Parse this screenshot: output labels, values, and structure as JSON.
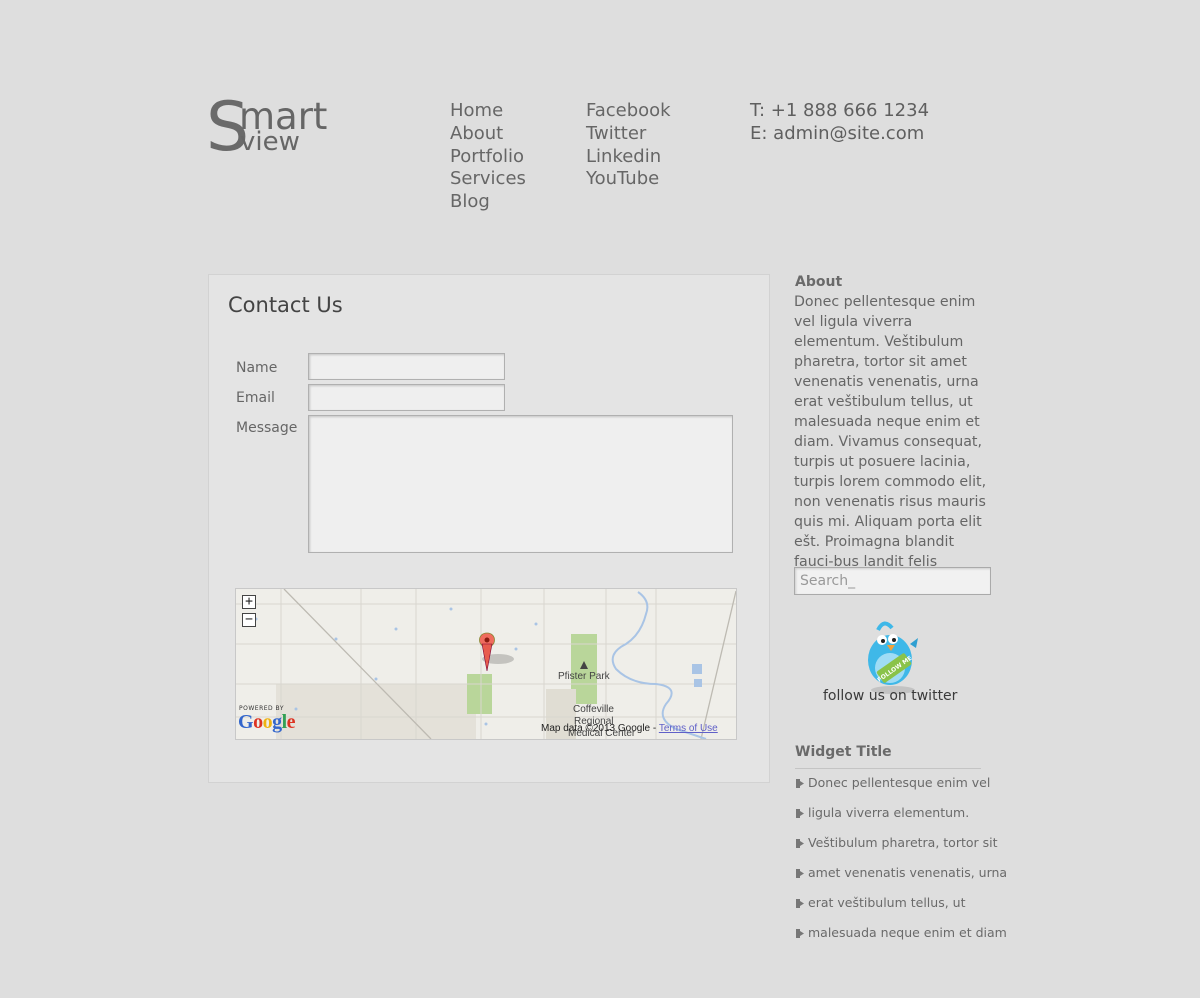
{
  "logo": {
    "letter": "S",
    "word1": "mart",
    "word2": "view"
  },
  "nav": {
    "main": [
      "Home",
      "About",
      "Portfolio",
      "Services",
      "Blog"
    ],
    "social": [
      "Facebook",
      "Twitter",
      "Linkedin",
      "YouTube"
    ]
  },
  "contact_info": {
    "phone": "T: +1 888 666 1234",
    "email": "E: admin@site.com"
  },
  "contact_form": {
    "title": "Contact Us",
    "name_label": "Name",
    "email_label": "Email",
    "message_label": "Message",
    "name_value": "",
    "email_value": "",
    "message_value": ""
  },
  "map": {
    "zoom_in": "+",
    "zoom_out": "−",
    "powered_by": "POWERED BY",
    "google_letters": [
      "G",
      "o",
      "o",
      "g",
      "l",
      "e"
    ],
    "map_data": "Map data ©2013 Google -",
    "terms": "Terms of Use",
    "places": {
      "park": "Pfister Park",
      "city": "Coffeville",
      "regional": "Regional",
      "medical": "Medical Center"
    },
    "marker_icon": "map-marker-icon"
  },
  "sidebar": {
    "about_title": "About",
    "about_text": "Donec pellentesque enim vel ligula viverra elementum. Veštibulum pharetra, tortor sit amet venenatis venenatis, urna erat veštibulum tellus, ut malesuada neque enim et diam. Vivamus consequat, turpis ut posuere lacinia, turpis lorem commodo elit, non venenatis risus mauris quis mi. Aliquam porta elit ešt. Proimagna blandit fauci-bus landit felis aliquet at.",
    "search_placeholder": "Search_",
    "twitter_badge": "FOLLOW ME",
    "follow_text": "follow us on twitter",
    "widget_title": "Widget Title",
    "widget_items": [
      "Donec pellentesque enim vel",
      "ligula viverra elementum.",
      "Veštibulum pharetra, tortor sit",
      "amet venenatis venenatis, urna",
      "erat veštibulum tellus, ut",
      "malesuada neque enim et diam"
    ]
  },
  "colors": {
    "background": "#dedede",
    "panel": "#e4e4e4",
    "text": "#666666",
    "twitter_blue": "#3fb8e8",
    "badge_green": "#8ac34a"
  }
}
